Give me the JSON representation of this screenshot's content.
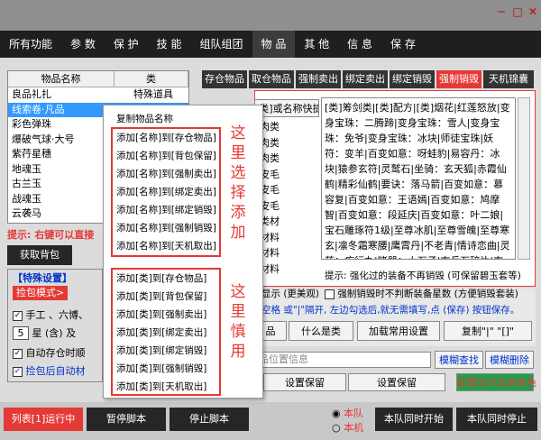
{
  "window": {
    "min": "─",
    "max": "□",
    "close": "✕"
  },
  "menu": [
    "所有功能",
    "参 数",
    "保 护",
    "技 能",
    "组队组团",
    "物 品",
    "其 他",
    "信 息",
    "保 存"
  ],
  "item_table": {
    "headers": [
      "物品名称",
      "类"
    ],
    "rows": [
      {
        "name": "良品礼扎",
        "type": "特殊道具"
      },
      {
        "name": "线索卷·凡品",
        "type": "特殊道具"
      },
      {
        "name": "彩色弹珠",
        "type": ""
      },
      {
        "name": "爆破气球·大号",
        "type": ""
      },
      {
        "name": "紫荇星穗",
        "type": ""
      },
      {
        "name": "地魂玉",
        "type": ""
      },
      {
        "name": "古兰玉",
        "type": ""
      },
      {
        "name": "战魂玉",
        "type": ""
      },
      {
        "name": "云袭马",
        "type": ""
      }
    ]
  },
  "hint_left": "提示: 右键可以直接",
  "left_mid_partial": [
    "肉类",
    "肉类",
    "肉类",
    "皮毛",
    "皮毛",
    "皮毛",
    "类材",
    "材料",
    "材料",
    "材料",
    "材料"
  ],
  "get_bag_btn": "获取背包",
  "special": {
    "title": "【特殊设置】",
    "pick_mode": "捡包模式>",
    "mode_value": "1",
    "opt1": "手工 、六博、",
    "opt1_value": "5",
    "opt2": "星 (含) 及",
    "opt3": "自动存仓时顺",
    "opt4": "捡包后自动材"
  },
  "tabs": [
    "存仓物品",
    "取仓物品",
    "强制卖出",
    "绑定卖出",
    "绑定销毁",
    "强制销毁",
    "天机锦囊"
  ],
  "tab_header": "[类]或名称快捷设置",
  "textarea": "[类]筹剑类|[类]配方|[类]烟花|红莲怒放|变身宝珠：二腾蹄|变身宝珠：雪人|变身宝珠：免爷|变身宝珠：冰块|师徒宝珠|妖符：变羊|百变如意：呀蛙豹|易容丹：冰块|猿参玄符|灵鹫石|坐骑：玄天狐|赤霞仙鹤|精彩仙鹤|要诀：落马箭|百变如意：慕容复|百变如意：王语嫣|百变如意：鸠摩智|百变如意：段延庆|百变如意：叶二娘|宝石雕琢符1级|至尊冰肌|至尊雪魄|至尊寒玄|凛冬霜寒腰|鹰霄丹|不老青|情诗恋曲|灵药：疾行丸|睹器：小石子|玄兵石碎片|玄兵石|无限的寒石|无限的雪",
  "hint_right": "提示: 强化过的装备不再销毁 (可保留碧玉套等)",
  "check_show": "显示 (更美观)",
  "check_force": "强制销毁时不判断装备星数 (方便销毁套装)",
  "sep_hint": "空格 或\"|\"隔开, 左边勾选后,就无需填写,点 (保存) 按钮保存。",
  "btns_row": [
    "品",
    "什么是类",
    "加载常用设置",
    "复制\"|\" \"[]\""
  ],
  "pos_label": "品位置信息",
  "fuzzy_find": "模糊查找",
  "fuzzy_del": "模糊删除",
  "set_keep1": "设置保留",
  "set_keep2": "设置保留",
  "config_sync": "配置同步其他角色",
  "ctx": {
    "copy": "复制物品名称",
    "name_items": [
      "添加[名称]到[存仓物品]",
      "添加[名称]到[背包保留]",
      "添加[名称]到[强制卖出]",
      "添加[名称]到[绑定卖出]",
      "添加[名称]到[绑定销毁]",
      "添加[名称]到[强制销毁]",
      "添加[名称]到[天机取出]"
    ],
    "class_items": [
      "添加[类]到[存仓物品]",
      "添加[类]到[背包保留]",
      "添加[类]到[强制卖出]",
      "添加[类]到[绑定卖出]",
      "添加[类]到[绑定销毁]",
      "添加[类]到[强制销毁]",
      "添加[类]到[天机取出]"
    ]
  },
  "annotation_top": [
    "这",
    "里",
    "选",
    "择",
    "添",
    "加"
  ],
  "annotation_bottom": [
    "这",
    "里",
    "慎",
    "用"
  ],
  "bottom": {
    "run": "列表[1]运行中",
    "pause": "暂停脚本",
    "stop": "停止脚本",
    "radio1": "本队",
    "radio2": "本机",
    "team_start": "本队同时开始",
    "team_stop": "本队同时停止"
  },
  "colors": {
    "accent": "#e53935",
    "dark": "#262626",
    "sync": "#1da14a"
  }
}
